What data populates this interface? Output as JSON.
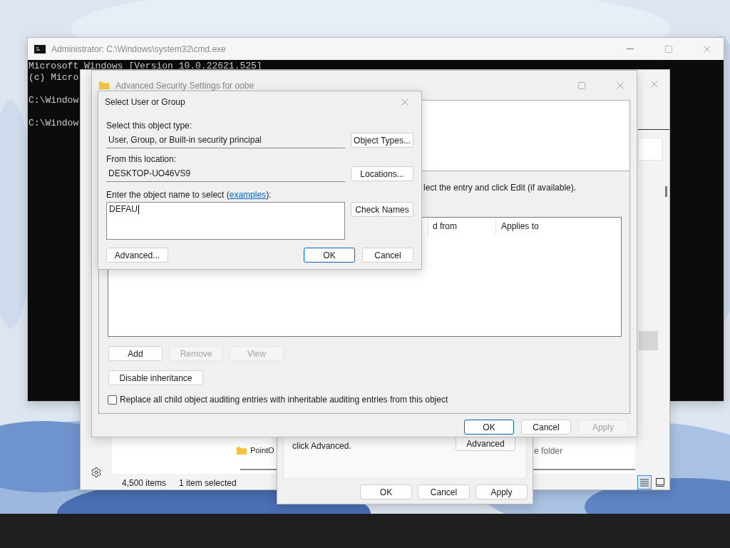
{
  "cmd_window": {
    "title": "Administrator: C:\\Windows\\system32\\cmd.exe",
    "lines": [
      {
        "kind": "output",
        "text": "Microsoft Windows [Version 10.0.22621.525]"
      },
      {
        "kind": "output",
        "text": "(c) Micro"
      },
      {
        "kind": "prompt",
        "text": "C:\\Window"
      },
      {
        "kind": "prompt",
        "text": "C:\\Window"
      }
    ]
  },
  "explorer_window": {
    "item_name": "PointO",
    "item_type": "e folder",
    "status_bar": {
      "item_count": "4,500 items",
      "selection": "1 item selected"
    },
    "view_buttons": [
      {
        "kind": "details",
        "selected": true
      },
      {
        "kind": "tiles",
        "selected": false
      }
    ]
  },
  "properties_dialog": {
    "hint": "click Advanced.",
    "advanced_button": "Advanced",
    "buttons": [
      "OK",
      "Cancel",
      "Apply"
    ]
  },
  "advanced_security_window": {
    "title": "Advanced Security Settings for oobe",
    "instruction": "lect the entry and click Edit (if available).",
    "columns": [
      "d from",
      "Applies to"
    ],
    "entry_buttons": [
      {
        "label": "Add",
        "disabled": false
      },
      {
        "label": "Remove",
        "disabled": true
      },
      {
        "label": "View",
        "disabled": true
      }
    ],
    "inheritance_button": "Disable inheritance",
    "replace_checkbox": {
      "label": "Replace all child object auditing entries with inheritable auditing entries from this object",
      "checked": false
    },
    "footer_buttons": [
      {
        "label": "OK",
        "default": true,
        "disabled": false
      },
      {
        "label": "Cancel",
        "default": false,
        "disabled": false
      },
      {
        "label": "Apply",
        "default": false,
        "disabled": true
      }
    ]
  },
  "select_dialog": {
    "title": "Select User or Group",
    "object_type": {
      "label": "Select this object type:",
      "value": "User, Group, or Built-in security principal",
      "button": "Object Types..."
    },
    "location": {
      "label": "From this location:",
      "value": "DESKTOP-UO46VS9",
      "button": "Locations..."
    },
    "name_entry": {
      "label_before": "Enter the object name to select (",
      "link": "examples",
      "label_after": "):",
      "value": "DEFAU",
      "button": "Check Names"
    },
    "buttons": [
      {
        "label": "Advanced...",
        "default": false
      },
      {
        "label": "OK",
        "default": true
      },
      {
        "label": "Cancel",
        "default": false
      }
    ]
  }
}
